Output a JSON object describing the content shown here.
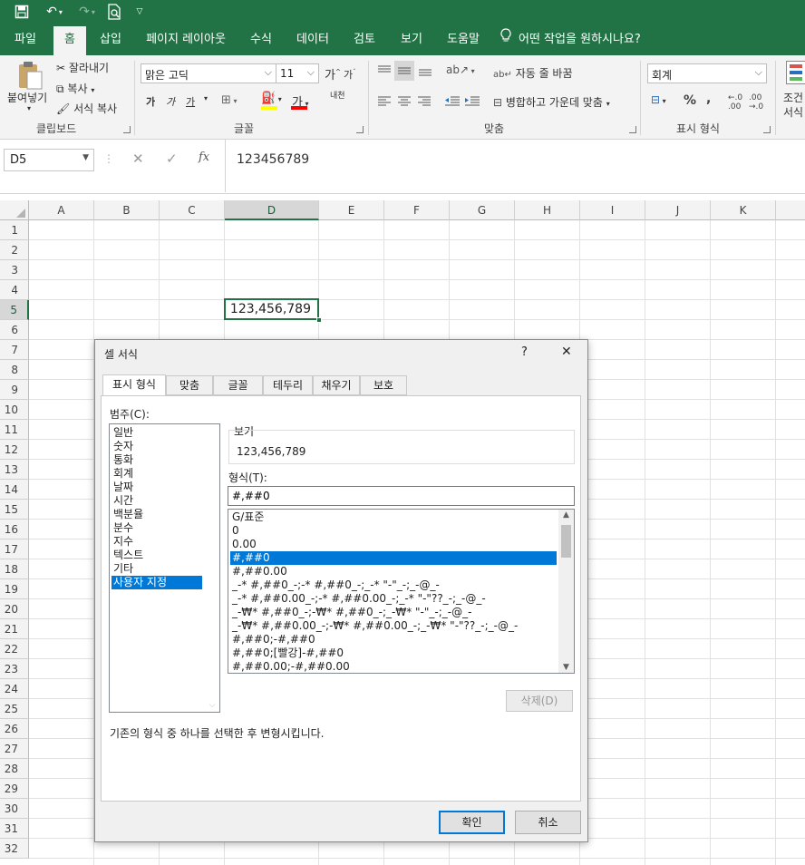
{
  "titlebar": {
    "icons": [
      "save-icon",
      "undo-icon",
      "redo-icon",
      "print-preview-icon",
      "customize-icon"
    ]
  },
  "ribbon_tabs": [
    "파일",
    "홈",
    "삽입",
    "페이지 레이아웃",
    "수식",
    "데이터",
    "검토",
    "보기",
    "도움말"
  ],
  "tell_me": "어떤 작업을 원하시나요?",
  "clipboard": {
    "paste": "붙여넣기",
    "cut": "잘라내기",
    "copy": "복사",
    "format_painter": "서식 복사",
    "group": "클립보드"
  },
  "font": {
    "name": "맑은 고딕",
    "size": "11",
    "group": "글꼴",
    "bold": "가",
    "italic": "가",
    "underline": "가",
    "color_letter": "가",
    "phonetic": "내천"
  },
  "alignment": {
    "wrap": "자동 줄 바꿈",
    "merge": "병합하고 가운데 맞춤",
    "group": "맞춤"
  },
  "number": {
    "format": "회계",
    "percent": "%",
    "comma": "،",
    "group": "표시 형식"
  },
  "styles": {
    "label1": "조건",
    "label2": "서식"
  },
  "formula_bar": {
    "name_box": "D5",
    "cancel": "✕",
    "enter": "✓",
    "fx": "fx",
    "content": "123456789"
  },
  "columns": [
    "A",
    "B",
    "C",
    "D",
    "E",
    "F",
    "G",
    "H",
    "I",
    "J",
    "K"
  ],
  "rows": [
    "1",
    "2",
    "3",
    "4",
    "5",
    "6",
    "7",
    "8",
    "9",
    "10",
    "11",
    "12",
    "13",
    "14",
    "15",
    "16",
    "17",
    "18",
    "19",
    "20",
    "21",
    "22",
    "23",
    "24",
    "25",
    "26",
    "27",
    "28",
    "29",
    "30",
    "31",
    "32"
  ],
  "selected_cell": {
    "value": "123,456,789"
  },
  "dialog": {
    "title": "셀 서식",
    "help": "?",
    "close": "✕",
    "tabs": [
      "표시 형식",
      "맞춤",
      "글꼴",
      "테두리",
      "채우기",
      "보호"
    ],
    "category_label": "범주(C):",
    "categories": [
      "일반",
      "숫자",
      "통화",
      "회계",
      "날짜",
      "시간",
      "백분율",
      "분수",
      "지수",
      "텍스트",
      "기타",
      "사용자 지정"
    ],
    "selected_category": "사용자 지정",
    "preview_label": "보기",
    "preview_value": "123,456,789",
    "type_label": "형식(T):",
    "type_value": "#,##0",
    "formats": [
      "G/표준",
      "0",
      "0.00",
      "#,##0",
      "#,##0.00",
      "_-* #,##0_-;-* #,##0_-;_-* \"-\"_-;_-@_-",
      "_-* #,##0.00_-;-* #,##0.00_-;_-* \"-\"??_-;_-@_-",
      "_-₩* #,##0_-;-₩* #,##0_-;_-₩* \"-\"_-;_-@_-",
      "_-₩* #,##0.00_-;-₩* #,##0.00_-;_-₩* \"-\"??_-;_-@_-",
      "#,##0;-#,##0",
      "#,##0;[빨강]-#,##0",
      "#,##0.00;-#,##0.00"
    ],
    "selected_format": "#,##0",
    "delete_button": "삭제(D)",
    "description": "기존의 형식 중 하나를 선택한 후 변형시킵니다.",
    "ok": "확인",
    "cancel": "취소"
  },
  "colors": {
    "accent": "#217346",
    "selection": "#0078d7"
  }
}
